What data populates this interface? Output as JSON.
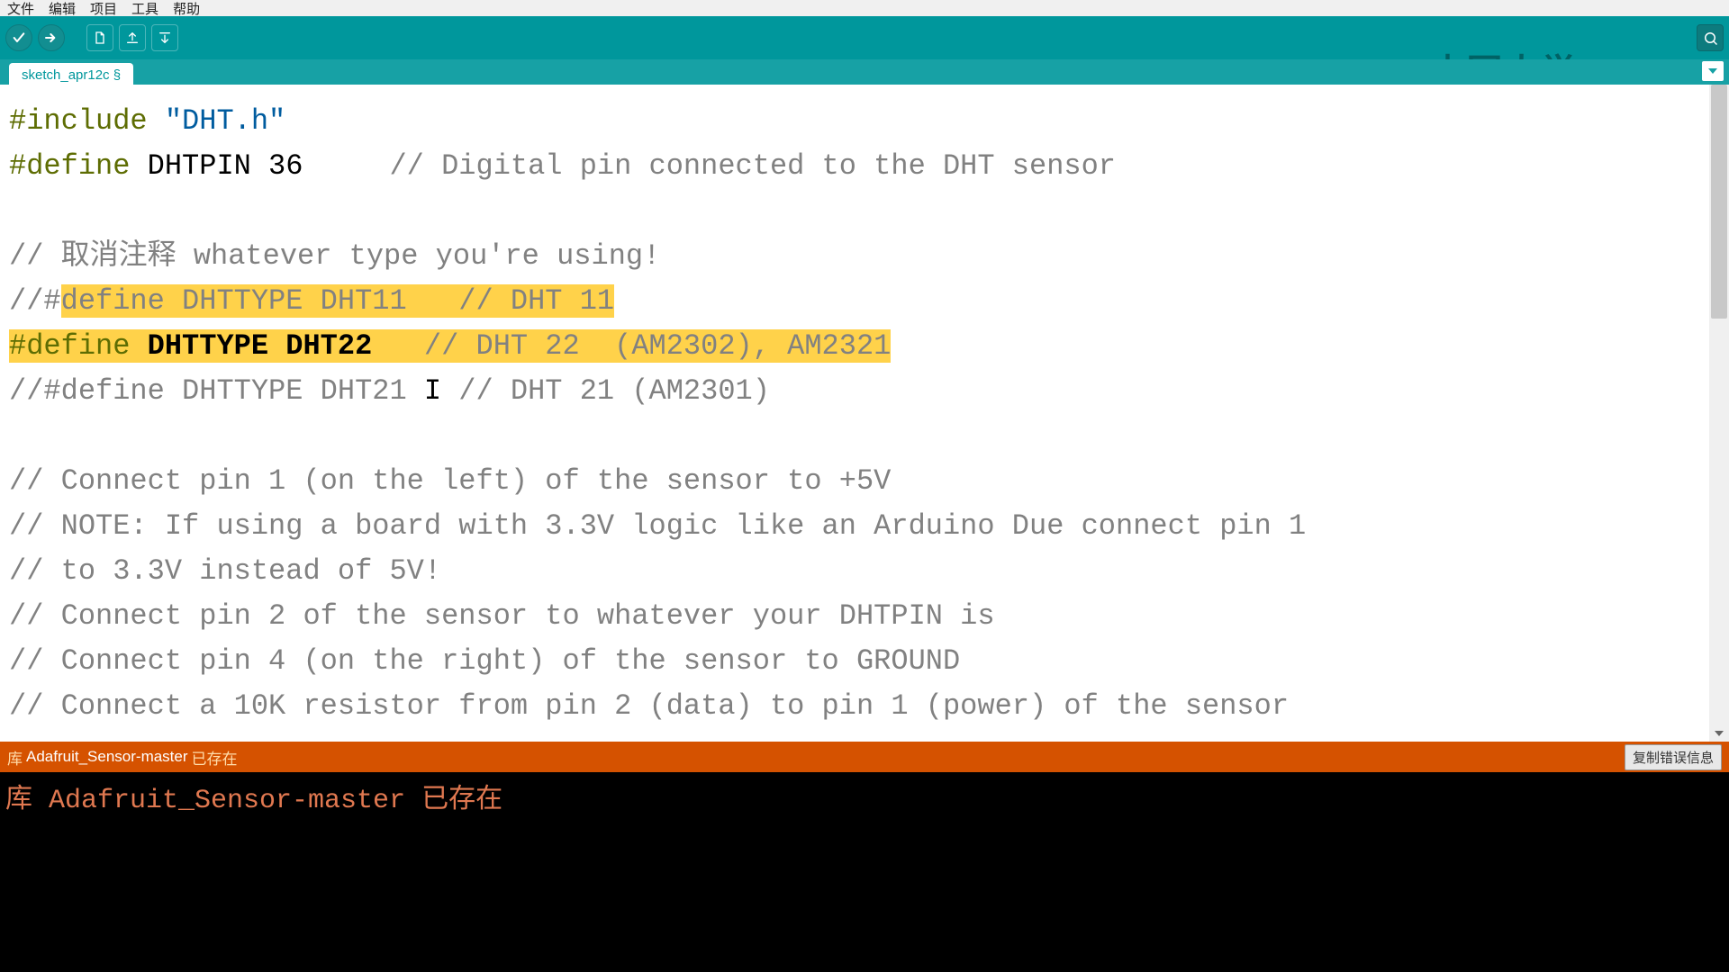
{
  "menu": {
    "items": [
      "文件",
      "编辑",
      "项目",
      "工具",
      "帮助"
    ]
  },
  "toolbar": {
    "verify": "verify",
    "upload": "upload",
    "new": "new",
    "open": "open",
    "save": "save",
    "serial_monitor": "serial-monitor"
  },
  "watermark": "中国大学MOOC",
  "tab": {
    "name": "sketch_apr12c §"
  },
  "code": {
    "l1_pp": "#include",
    "l1_str": " \"DHT.h\"",
    "l2_pp": "#define",
    "l2_rest": " DHTPIN 36     ",
    "l2_com": "// Digital pin connected to the DHT sensor",
    "l3": "",
    "l4_com": "// 取消注释 whatever type you're using!",
    "l5_a": "//#",
    "l5_h": "define DHTTYPE DHT11   // DHT 11",
    "l6_pp": "#define",
    "l6_macro": " DHTTYPE DHT22   ",
    "l6_com": "// DHT 22  (AM2302), AM2321",
    "l7_a": "//#define DHTTYPE DHT21 ",
    "l7_caret": "I",
    "l7_b": " // DHT 21 (AM2301)",
    "l8": "",
    "l9": "// Connect pin 1 (on the left) of the sensor to +5V",
    "l10": "// NOTE: If using a board with 3.3V logic like an Arduino Due connect pin 1",
    "l11": "// to 3.3V instead of 5V!",
    "l12": "// Connect pin 2 of the sensor to whatever your DHTPIN is",
    "l13": "// Connect pin 4 (on the right) of the sensor to GROUND",
    "l14": "// Connect a 10K resistor from pin 2 (data) to pin 1 (power) of the sensor"
  },
  "status": {
    "prefix": "库",
    "lib": "Adafruit_Sensor-master",
    "suffix": "已存在",
    "copy_btn": "复制错误信息"
  },
  "console": {
    "line1": "库 Adafruit_Sensor-master 已存在"
  }
}
